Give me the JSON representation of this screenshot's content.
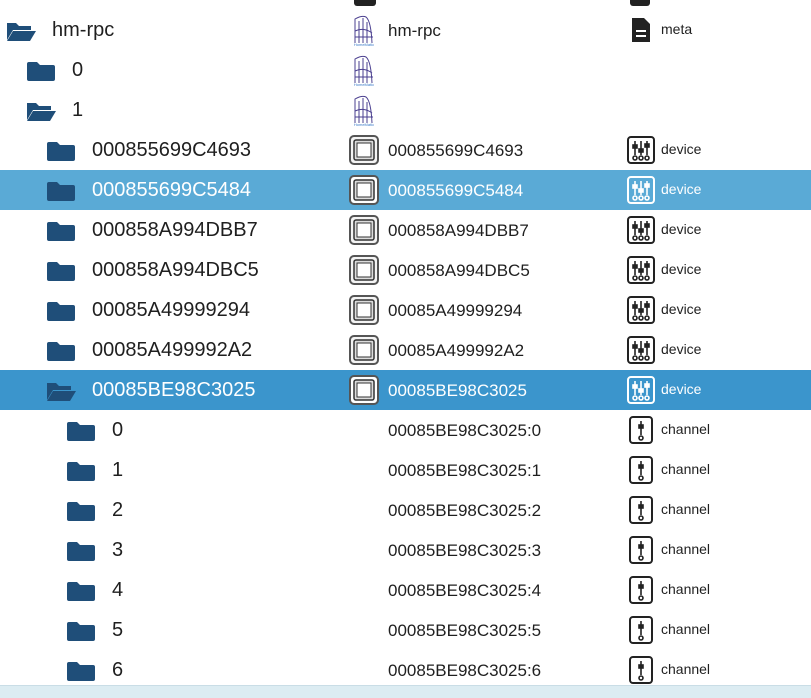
{
  "colors": {
    "folder": "#1f4e79",
    "row_hover": "#5aaad6",
    "row_selected": "#3b95cc",
    "text": "#1f1f1f",
    "bottom_bar": "#dcecf2"
  },
  "rows": [
    {
      "name": "hm-rpc",
      "indent": 0,
      "open": true,
      "icon": "homematic-logo-icon",
      "col_name": "hm-rpc",
      "type_icon": "file-icon",
      "type": "meta",
      "state": ""
    },
    {
      "name": "0",
      "indent": 1,
      "open": false,
      "icon": "homematic-logo-icon",
      "col_name": "",
      "type_icon": "",
      "type": "",
      "state": ""
    },
    {
      "name": "1",
      "indent": 1,
      "open": true,
      "icon": "homematic-logo-icon",
      "col_name": "",
      "type_icon": "",
      "type": "",
      "state": ""
    },
    {
      "name": "000855699C4693",
      "indent": 2,
      "open": false,
      "icon": "device-square-icon",
      "col_name": "000855699C4693",
      "type_icon": "sliders-icon",
      "type": "device",
      "state": ""
    },
    {
      "name": "000855699C5484",
      "indent": 2,
      "open": false,
      "icon": "device-square-icon",
      "col_name": "000855699C5484",
      "type_icon": "sliders-icon",
      "type": "device",
      "state": "hover"
    },
    {
      "name": "000858A994DBB7",
      "indent": 2,
      "open": false,
      "icon": "device-square-icon",
      "col_name": "000858A994DBB7",
      "type_icon": "sliders-icon",
      "type": "device",
      "state": ""
    },
    {
      "name": "000858A994DBC5",
      "indent": 2,
      "open": false,
      "icon": "device-square-icon",
      "col_name": "000858A994DBC5",
      "type_icon": "sliders-icon",
      "type": "device",
      "state": ""
    },
    {
      "name": "00085A49999294",
      "indent": 2,
      "open": false,
      "icon": "device-square-icon",
      "col_name": "00085A49999294",
      "type_icon": "sliders-icon",
      "type": "device",
      "state": ""
    },
    {
      "name": "00085A499992A2",
      "indent": 2,
      "open": false,
      "icon": "device-square-icon",
      "col_name": "00085A499992A2",
      "type_icon": "sliders-icon",
      "type": "device",
      "state": ""
    },
    {
      "name": "00085BE98C3025",
      "indent": 2,
      "open": true,
      "icon": "device-square-icon",
      "col_name": "00085BE98C3025",
      "type_icon": "sliders-icon",
      "type": "device",
      "state": "selected"
    },
    {
      "name": "0",
      "indent": 3,
      "open": false,
      "icon": "",
      "col_name": "00085BE98C3025:0",
      "type_icon": "channel-icon",
      "type": "channel",
      "state": ""
    },
    {
      "name": "1",
      "indent": 3,
      "open": false,
      "icon": "",
      "col_name": "00085BE98C3025:1",
      "type_icon": "channel-icon",
      "type": "channel",
      "state": ""
    },
    {
      "name": "2",
      "indent": 3,
      "open": false,
      "icon": "",
      "col_name": "00085BE98C3025:2",
      "type_icon": "channel-icon",
      "type": "channel",
      "state": ""
    },
    {
      "name": "3",
      "indent": 3,
      "open": false,
      "icon": "",
      "col_name": "00085BE98C3025:3",
      "type_icon": "channel-icon",
      "type": "channel",
      "state": ""
    },
    {
      "name": "4",
      "indent": 3,
      "open": false,
      "icon": "",
      "col_name": "00085BE98C3025:4",
      "type_icon": "channel-icon",
      "type": "channel",
      "state": ""
    },
    {
      "name": "5",
      "indent": 3,
      "open": false,
      "icon": "",
      "col_name": "00085BE98C3025:5",
      "type_icon": "channel-icon",
      "type": "channel",
      "state": ""
    },
    {
      "name": "6",
      "indent": 3,
      "open": false,
      "icon": "",
      "col_name": "00085BE98C3025:6",
      "type_icon": "channel-icon",
      "type": "channel",
      "state": ""
    }
  ]
}
